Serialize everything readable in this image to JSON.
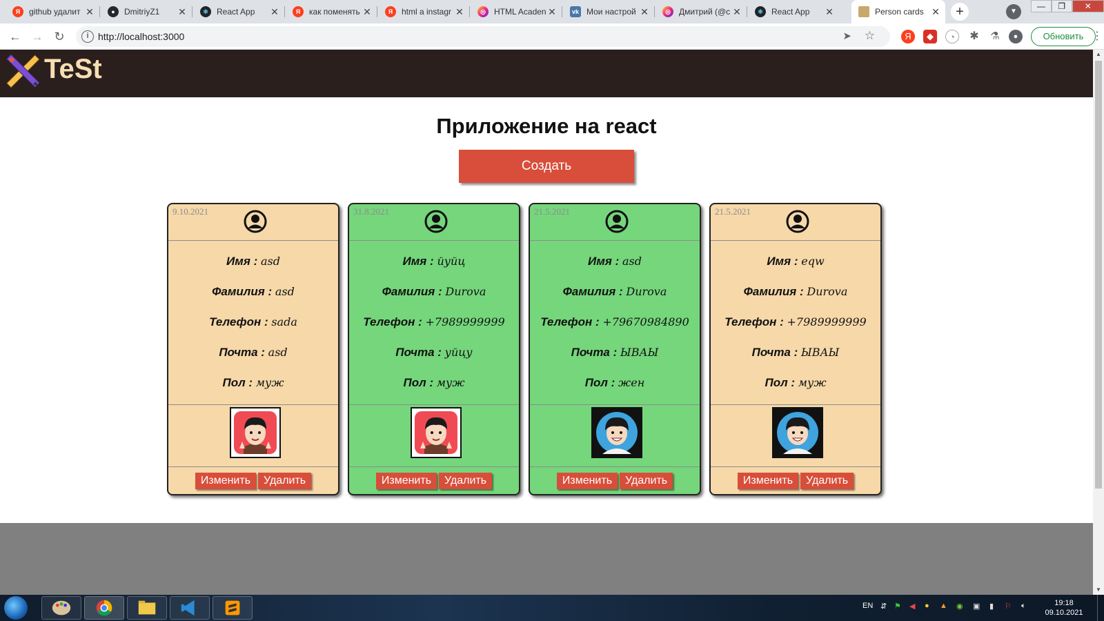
{
  "browser": {
    "tabs": [
      {
        "title": "github удалит",
        "favicon": "yandex-icon",
        "color": "#fc3f1d",
        "active": false
      },
      {
        "title": "DmitriyZ1",
        "favicon": "github-icon",
        "color": "#24292e",
        "active": false
      },
      {
        "title": "React App",
        "favicon": "react-icon",
        "color": "#20232a",
        "active": false
      },
      {
        "title": "как поменять",
        "favicon": "yandex-icon",
        "color": "#fc3f1d",
        "active": false
      },
      {
        "title": "html a instagr",
        "favicon": "yandex-icon",
        "color": "#fc3f1d",
        "active": false
      },
      {
        "title": "HTML Acaden",
        "favicon": "instagram-icon",
        "color": "#d6249f",
        "active": false
      },
      {
        "title": "Мои настрой",
        "favicon": "vk-icon",
        "color": "#4a76a8",
        "active": false
      },
      {
        "title": "Дмитрий (@c",
        "favicon": "instagram-icon",
        "color": "#d6249f",
        "active": false
      },
      {
        "title": "React App",
        "favicon": "react-icon",
        "color": "#20232a",
        "active": false
      },
      {
        "title": "Person cards",
        "favicon": "page-icon",
        "color": "#c9a86b",
        "active": true
      }
    ],
    "url": "http://localhost:3000",
    "update_label": "Обновить"
  },
  "site": {
    "logo_text": "TeSt",
    "title": "Приложение на react",
    "create_label": "Создать"
  },
  "labels": {
    "first_name": "Имя",
    "last_name": "Фамилия",
    "phone": "Телефон",
    "email": "Почта",
    "gender": "Пол",
    "separator": " : ",
    "edit": "Изменить",
    "delete": "Удалить"
  },
  "cards": [
    {
      "date": "9.10.2021",
      "first_name": "asd",
      "last_name": "asd",
      "phone": "sada",
      "email": "asd",
      "gender": "муж",
      "color": "#f6d8a9",
      "photo": "avatar-red-icon"
    },
    {
      "date": "31.8.2021",
      "first_name": "йуйц",
      "last_name": "Durova",
      "phone": "+7989999999",
      "email": "уйцу",
      "gender": "муж",
      "color": "#75d67c",
      "photo": "avatar-red-icon"
    },
    {
      "date": "21.5.2021",
      "first_name": "asd",
      "last_name": "Durova",
      "phone": "+79670984890",
      "email": "ЫВАЫ",
      "gender": "жен",
      "color": "#75d67c",
      "photo": "avatar-blue-icon"
    },
    {
      "date": "21.5.2021",
      "first_name": "eqw",
      "last_name": "Durova",
      "phone": "+7989999999",
      "email": "ЫВАЫ",
      "gender": "муж",
      "color": "#f6d8a9",
      "photo": "avatar-blue-icon"
    }
  ],
  "taskbar": {
    "lang": "EN",
    "time": "19:18",
    "date": "09.10.2021"
  }
}
